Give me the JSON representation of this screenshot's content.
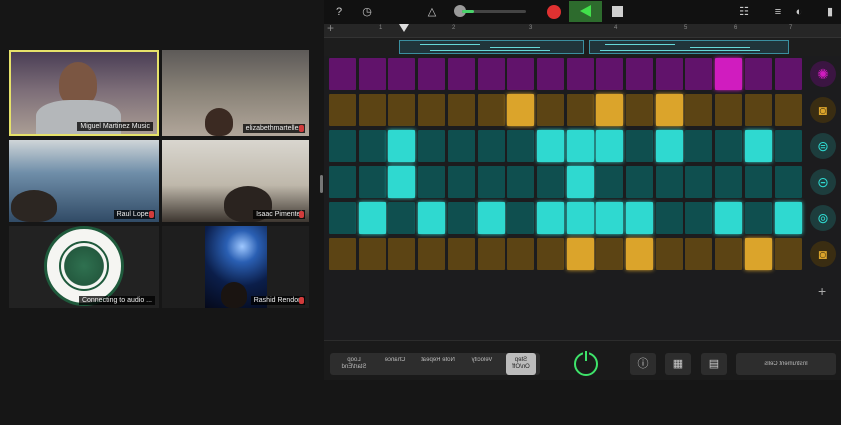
{
  "colors": {
    "pink_off": "#61136b",
    "pink_on": "#d01cbf",
    "orange_off": "#5c4414",
    "orange_on": "#dba42b",
    "teal_off": "#0f4f4f",
    "teal_on": "#2fd9d0",
    "record": "#e03131",
    "play": "#42e04b",
    "power": "#3ee36a"
  },
  "conference": {
    "participants": [
      {
        "name": "Miguel Martinez Music",
        "speaking": true,
        "muted": false
      },
      {
        "name": "elizabethmartellez",
        "speaking": false,
        "muted": true
      },
      {
        "name": "Raul Lopez",
        "speaking": false,
        "muted": true
      },
      {
        "name": "Isaac Pimentel",
        "speaking": false,
        "muted": true
      },
      {
        "name": "Connecting to audio ...",
        "speaking": false,
        "muted": false
      },
      {
        "name": "Rashid Rendon",
        "speaking": false,
        "muted": true
      }
    ]
  },
  "garageband": {
    "ruler": [
      "1",
      "2",
      "3",
      "4",
      "5",
      "6",
      "7"
    ],
    "rows": [
      {
        "instrument": "cymbal-kit",
        "color": "pink",
        "steps": [
          0,
          0,
          0,
          0,
          0,
          0,
          0,
          0,
          0,
          0,
          0,
          0,
          0,
          1,
          0,
          0
        ]
      },
      {
        "instrument": "snare-drum",
        "color": "orange",
        "steps": [
          0,
          0,
          0,
          0,
          0,
          0,
          1,
          0,
          0,
          1,
          0,
          1,
          0,
          0,
          0,
          0
        ]
      },
      {
        "instrument": "hi-hat",
        "color": "teal",
        "steps": [
          0,
          0,
          1,
          0,
          0,
          0,
          0,
          1,
          1,
          1,
          0,
          1,
          0,
          0,
          1,
          0
        ]
      },
      {
        "instrument": "hi-hat-open",
        "color": "teal",
        "steps": [
          0,
          0,
          1,
          0,
          0,
          0,
          0,
          0,
          1,
          0,
          0,
          0,
          0,
          0,
          0,
          0
        ]
      },
      {
        "instrument": "tom",
        "color": "teal",
        "steps": [
          0,
          1,
          0,
          1,
          0,
          1,
          0,
          1,
          1,
          1,
          1,
          0,
          0,
          1,
          0,
          1
        ]
      },
      {
        "instrument": "kick-drum",
        "color": "orange",
        "steps": [
          0,
          0,
          0,
          0,
          0,
          0,
          0,
          0,
          1,
          0,
          1,
          0,
          0,
          0,
          1,
          0
        ]
      }
    ],
    "bottom": {
      "segments_left": [
        "Loop Start/End",
        "Chance",
        "Note Repeat",
        "Velocity",
        "Step On/Off"
      ],
      "active_segment": "Step On/Off",
      "right_label": "Instrument Cells"
    }
  }
}
